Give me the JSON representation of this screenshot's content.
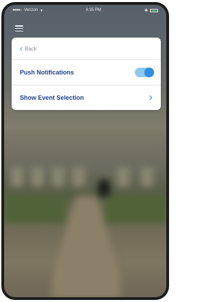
{
  "status_bar": {
    "carrier": "Verizon",
    "time": "4:35 PM"
  },
  "header": {
    "menu_icon": "hamburger-menu-icon"
  },
  "panel": {
    "back_label": "Back",
    "push_notifications_label": "Push Notifications",
    "push_notifications_on": true,
    "event_selection_label": "Show Event Selection"
  },
  "colors": {
    "accent": "#2f8fe0",
    "label": "#1f3f8a"
  }
}
